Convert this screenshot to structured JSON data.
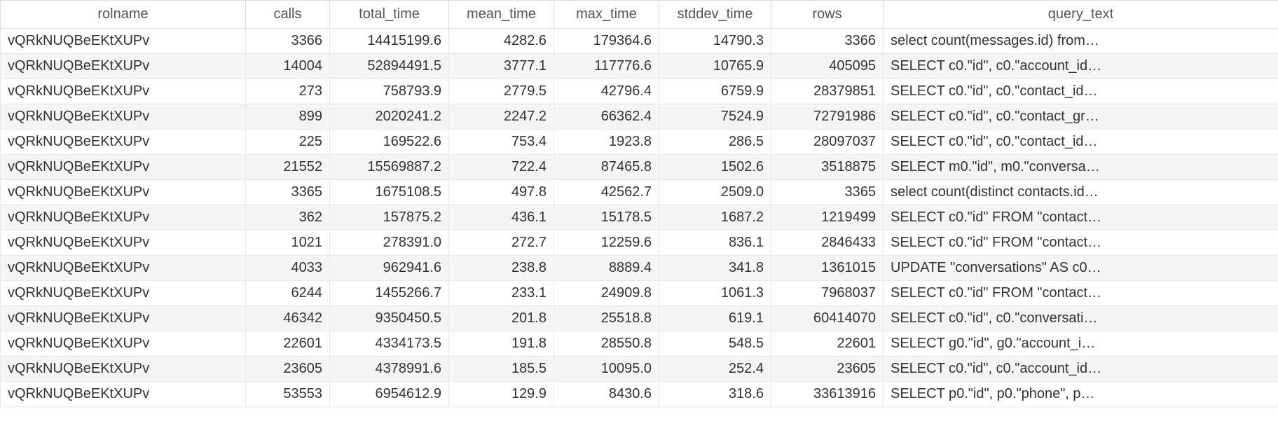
{
  "table": {
    "columns": [
      {
        "key": "rolname",
        "label": "rolname",
        "align": "txt"
      },
      {
        "key": "calls",
        "label": "calls",
        "align": "num"
      },
      {
        "key": "total_time",
        "label": "total_time",
        "align": "num"
      },
      {
        "key": "mean_time",
        "label": "mean_time",
        "align": "num"
      },
      {
        "key": "max_time",
        "label": "max_time",
        "align": "num"
      },
      {
        "key": "stddev_time",
        "label": "stddev_time",
        "align": "num"
      },
      {
        "key": "rows",
        "label": "rows",
        "align": "num"
      },
      {
        "key": "query_text",
        "label": "query_text",
        "align": "txt"
      }
    ],
    "rows": [
      {
        "rolname": "vQRkNUQBeEKtXUPv",
        "calls": "3366",
        "total_time": "14415199.6",
        "mean_time": "4282.6",
        "max_time": "179364.6",
        "stddev_time": "14790.3",
        "rows": "3366",
        "query_text": "select count(messages.id) from…"
      },
      {
        "rolname": "vQRkNUQBeEKtXUPv",
        "calls": "14004",
        "total_time": "52894491.5",
        "mean_time": "3777.1",
        "max_time": "117776.6",
        "stddev_time": "10765.9",
        "rows": "405095",
        "query_text": "SELECT c0.\"id\", c0.\"account_id…"
      },
      {
        "rolname": "vQRkNUQBeEKtXUPv",
        "calls": "273",
        "total_time": "758793.9",
        "mean_time": "2779.5",
        "max_time": "42796.4",
        "stddev_time": "6759.9",
        "rows": "28379851",
        "query_text": "SELECT c0.\"id\", c0.\"contact_id…"
      },
      {
        "rolname": "vQRkNUQBeEKtXUPv",
        "calls": "899",
        "total_time": "2020241.2",
        "mean_time": "2247.2",
        "max_time": "66362.4",
        "stddev_time": "7524.9",
        "rows": "72791986",
        "query_text": "SELECT c0.\"id\", c0.\"contact_gr…"
      },
      {
        "rolname": "vQRkNUQBeEKtXUPv",
        "calls": "225",
        "total_time": "169522.6",
        "mean_time": "753.4",
        "max_time": "1923.8",
        "stddev_time": "286.5",
        "rows": "28097037",
        "query_text": "SELECT c0.\"id\", c0.\"contact_id…"
      },
      {
        "rolname": "vQRkNUQBeEKtXUPv",
        "calls": "21552",
        "total_time": "15569887.2",
        "mean_time": "722.4",
        "max_time": "87465.8",
        "stddev_time": "1502.6",
        "rows": "3518875",
        "query_text": "SELECT m0.\"id\", m0.\"conversa…"
      },
      {
        "rolname": "vQRkNUQBeEKtXUPv",
        "calls": "3365",
        "total_time": "1675108.5",
        "mean_time": "497.8",
        "max_time": "42562.7",
        "stddev_time": "2509.0",
        "rows": "3365",
        "query_text": "select count(distinct contacts.id…"
      },
      {
        "rolname": "vQRkNUQBeEKtXUPv",
        "calls": "362",
        "total_time": "157875.2",
        "mean_time": "436.1",
        "max_time": "15178.5",
        "stddev_time": "1687.2",
        "rows": "1219499",
        "query_text": "SELECT c0.\"id\" FROM \"contact…"
      },
      {
        "rolname": "vQRkNUQBeEKtXUPv",
        "calls": "1021",
        "total_time": "278391.0",
        "mean_time": "272.7",
        "max_time": "12259.6",
        "stddev_time": "836.1",
        "rows": "2846433",
        "query_text": "SELECT c0.\"id\" FROM \"contact…"
      },
      {
        "rolname": "vQRkNUQBeEKtXUPv",
        "calls": "4033",
        "total_time": "962941.6",
        "mean_time": "238.8",
        "max_time": "8889.4",
        "stddev_time": "341.8",
        "rows": "1361015",
        "query_text": "UPDATE \"conversations\" AS c0…"
      },
      {
        "rolname": "vQRkNUQBeEKtXUPv",
        "calls": "6244",
        "total_time": "1455266.7",
        "mean_time": "233.1",
        "max_time": "24909.8",
        "stddev_time": "1061.3",
        "rows": "7968037",
        "query_text": "SELECT c0.\"id\" FROM \"contact…"
      },
      {
        "rolname": "vQRkNUQBeEKtXUPv",
        "calls": "46342",
        "total_time": "9350450.5",
        "mean_time": "201.8",
        "max_time": "25518.8",
        "stddev_time": "619.1",
        "rows": "60414070",
        "query_text": "SELECT c0.\"id\", c0.\"conversati…"
      },
      {
        "rolname": "vQRkNUQBeEKtXUPv",
        "calls": "22601",
        "total_time": "4334173.5",
        "mean_time": "191.8",
        "max_time": "28550.8",
        "stddev_time": "548.5",
        "rows": "22601",
        "query_text": "SELECT g0.\"id\", g0.\"account_i…"
      },
      {
        "rolname": "vQRkNUQBeEKtXUPv",
        "calls": "23605",
        "total_time": "4378991.6",
        "mean_time": "185.5",
        "max_time": "10095.0",
        "stddev_time": "252.4",
        "rows": "23605",
        "query_text": "SELECT c0.\"id\", c0.\"account_id…"
      },
      {
        "rolname": "vQRkNUQBeEKtXUPv",
        "calls": "53553",
        "total_time": "6954612.9",
        "mean_time": "129.9",
        "max_time": "8430.6",
        "stddev_time": "318.6",
        "rows": "33613916",
        "query_text": "SELECT p0.\"id\", p0.\"phone\", p…"
      }
    ]
  }
}
